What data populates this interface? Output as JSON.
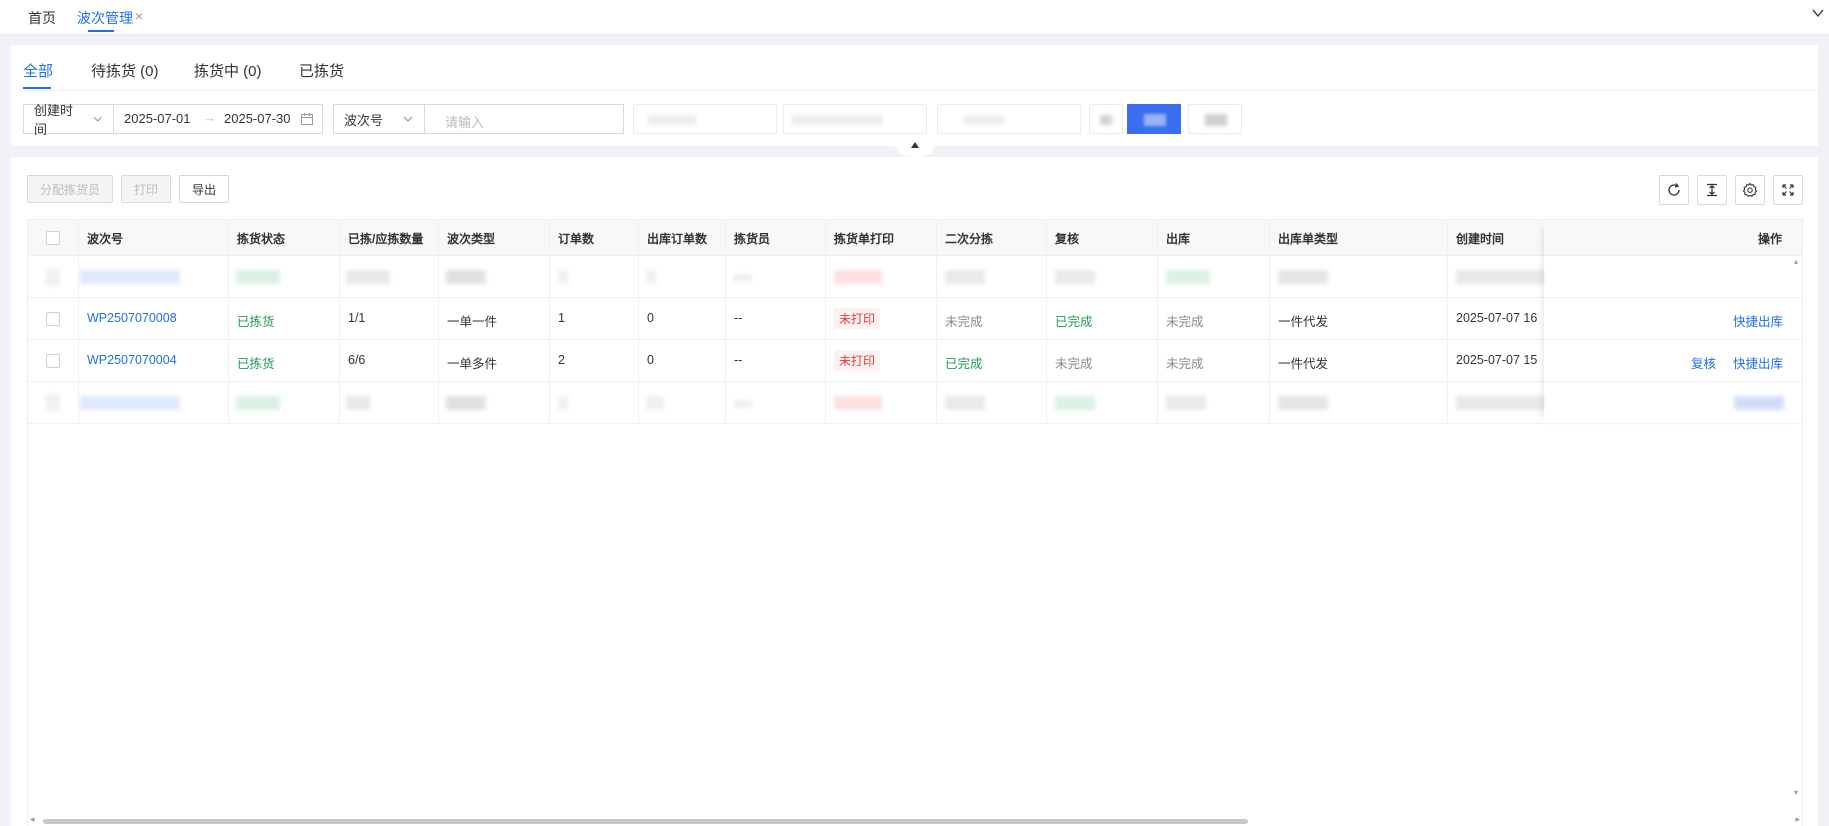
{
  "top_tabs": {
    "home": "首页",
    "active": "波次管理",
    "close": "×"
  },
  "status_tabs": [
    {
      "label": "全部"
    },
    {
      "label": "待拣货 (0)"
    },
    {
      "label": "拣货中 (0)"
    },
    {
      "label": "已拣货"
    }
  ],
  "filters": {
    "date_field": "创建时间",
    "date_start": "2025-07-01",
    "arrow": "→",
    "date_end": "2025-07-30",
    "search_field": "波次号",
    "search_placeholder": "请输入"
  },
  "toolbar": {
    "assign": "分配拣货员",
    "print": "打印",
    "export": "导出"
  },
  "table": {
    "columns": [
      "波次号",
      "拣货状态",
      "已拣/应拣数量",
      "波次类型",
      "订单数",
      "出库订单数",
      "拣货员",
      "拣货单打印",
      "二次分拣",
      "复核",
      "出库",
      "出库单类型",
      "创建时间"
    ],
    "actions_header": "操作",
    "rows": [
      {
        "wave_no": "WP2507070008",
        "status": "已拣货",
        "qty": "1/1",
        "type": "一单一件",
        "orders": "1",
        "out_orders": "0",
        "picker": "--",
        "print": "未打印",
        "secondary": "未完成",
        "review": "已完成",
        "outbound": "未完成",
        "out_type": "一件代发",
        "created": "2025-07-07 16",
        "actions": [
          "快捷出库"
        ]
      },
      {
        "wave_no": "WP2507070004",
        "status": "已拣货",
        "qty": "6/6",
        "type": "一单多件",
        "orders": "2",
        "out_orders": "0",
        "picker": "--",
        "print": "未打印",
        "secondary": "已完成",
        "review": "未完成",
        "outbound": "未完成",
        "out_type": "一件代发",
        "created": "2025-07-07 15",
        "actions": [
          "复核",
          "快捷出库"
        ]
      }
    ]
  },
  "colors": {
    "primary": "#1f6fe6",
    "success": "#1c9c56",
    "danger": "#e23b3b"
  }
}
